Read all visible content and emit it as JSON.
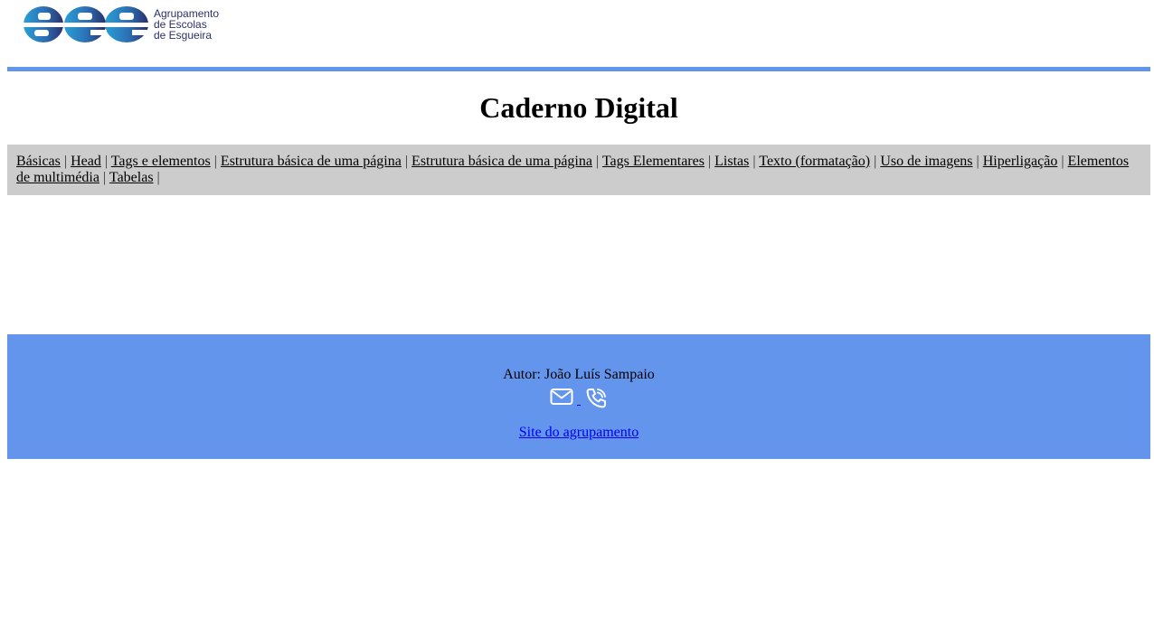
{
  "header": {
    "logo_alt": "aee",
    "logo_lines": [
      "Agrupamento",
      "de Escolas",
      "de Esgueira"
    ]
  },
  "page": {
    "title": "Caderno Digital"
  },
  "nav": {
    "items": [
      "Básicas",
      "Head",
      "Tags e elementos",
      "Estrutura básica de uma página",
      "Estrutura básica de uma página",
      "Tags Elementares",
      "Listas",
      "Texto (formatação)",
      "Uso de imagens",
      "Hiperligação",
      "Elementos de multimédia",
      "Tabelas"
    ],
    "separator": "|"
  },
  "footer": {
    "author": "Autor: João Luís Sampaio",
    "email_icon": "envelope-icon",
    "phone_icon": "phone-icon",
    "site_link": "Site do agrupamento"
  },
  "colors": {
    "accent": "#6495ed",
    "nav_bg": "#cccccc",
    "link_blue": "#0000ee",
    "logo_light": "#2a9fd6",
    "logo_dark": "#2b2f6b"
  }
}
